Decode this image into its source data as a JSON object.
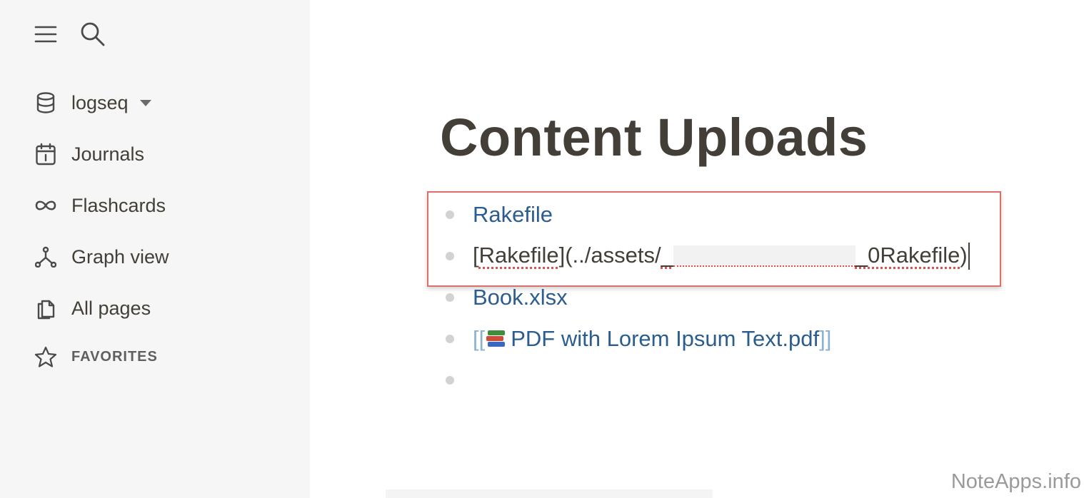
{
  "sidebar": {
    "menu_icon": "hamburger-icon",
    "search_icon": "search-icon",
    "repo": {
      "label": "logseq",
      "icon": "database-icon"
    },
    "items": [
      {
        "label": "Journals",
        "icon": "calendar-icon"
      },
      {
        "label": "Flashcards",
        "icon": "infinity-icon"
      },
      {
        "label": "Graph view",
        "icon": "graph-icon"
      },
      {
        "label": "All pages",
        "icon": "pages-icon"
      }
    ],
    "favorites": {
      "label": "FAVORITES",
      "icon": "star-icon"
    }
  },
  "page": {
    "title": "Content Uploads",
    "blocks": [
      {
        "type": "link",
        "text": "Rakefile"
      },
      {
        "type": "editing",
        "prefix": "[",
        "word": "Rakefile",
        "middle": "](../assets/",
        "underscore_a": "_",
        "underscore_b": "_",
        "suffix_word": "0Rakefile",
        "suffix": ")"
      },
      {
        "type": "link",
        "text": "Book.xlsx"
      },
      {
        "type": "page-ref",
        "open": "[[",
        "text": " PDF with Lorem Ipsum Text.pdf",
        "close": "]]",
        "emoji": "books-emoji"
      },
      {
        "type": "empty",
        "text": ""
      }
    ]
  },
  "watermark": "NoteApps.info",
  "colors": {
    "link": "#2b5e8f",
    "highlight_border": "#d9706b",
    "sidebar_bg": "#f6f6f6"
  }
}
